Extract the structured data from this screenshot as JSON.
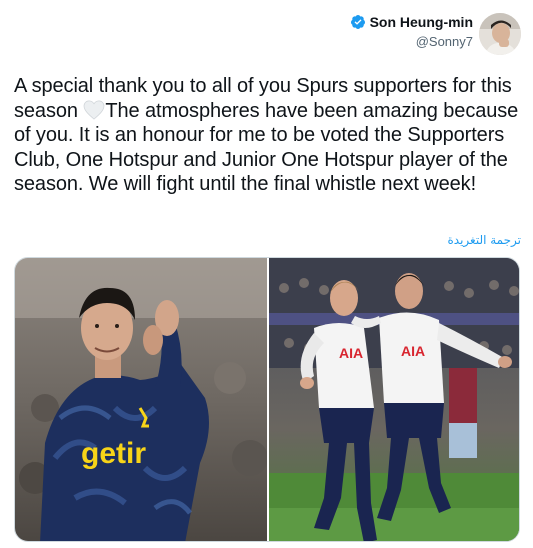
{
  "author": {
    "display_name": "Son Heung-min",
    "handle": "@Sonny7",
    "verified": true
  },
  "tweet": {
    "text_part1": "A special thank you to all of you Spurs supporters for this season ",
    "text_part2": "The atmospheres have been amazing because of you. It is an honour for me to be voted the Supporters Club, One Hotspur and Junior One Hotspur player of the season. We will fight until the final whistle next week!",
    "emoji": "white-heart-icon"
  },
  "translate_label": "ترجمة التغريدة",
  "media": {
    "photos": [
      {
        "name": "son-applauding-photo",
        "sponsor_text": "getir"
      },
      {
        "name": "son-kane-celebrating-photo",
        "sponsor_text_1": "AIA",
        "sponsor_text_2": "AIA"
      }
    ]
  },
  "colors": {
    "link": "#1d9bf0",
    "verified": "#1d9bf0",
    "text": "#0f1419",
    "secondary": "#536471"
  }
}
